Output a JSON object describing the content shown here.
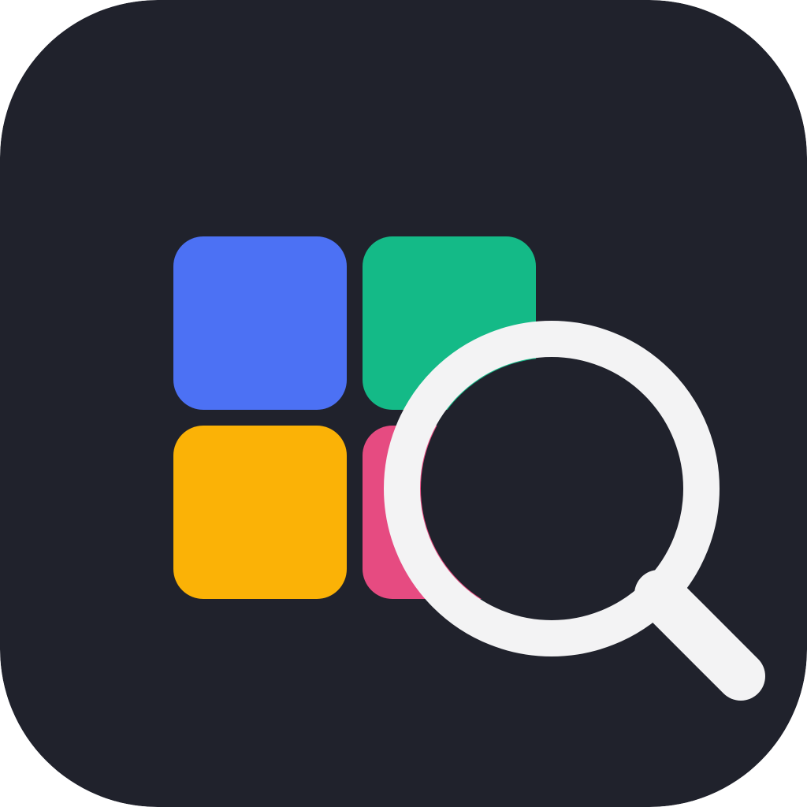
{
  "icon": {
    "name": "app-icon",
    "background_color": "#20222c",
    "tiles": [
      {
        "name": "blue-tile",
        "color": "#4c71f4"
      },
      {
        "name": "green-tile",
        "color": "#14ba87"
      },
      {
        "name": "yellow-tile",
        "color": "#fbb206"
      },
      {
        "name": "pink-tile",
        "color": "#e64b81"
      }
    ],
    "magnifier": {
      "name": "magnifying-glass-icon",
      "color": "#f3f3f4"
    }
  }
}
